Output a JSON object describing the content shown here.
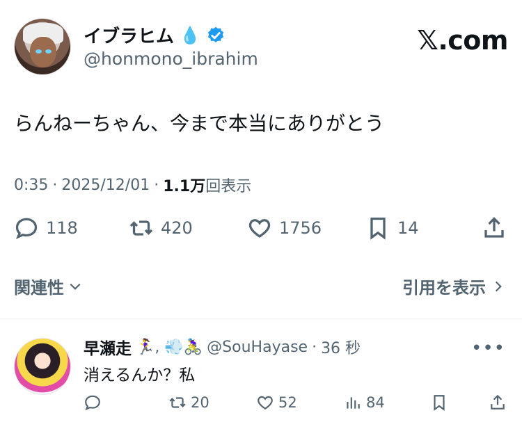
{
  "author": {
    "name": "イブラヒム",
    "name_emoji": "💧",
    "handle": "@honmono_ibrahim",
    "verified_icon": "verified-badge-icon"
  },
  "brand": "𝕏.com",
  "tweet": {
    "text": "らんねーちゃん、今まで本当にありがとう",
    "time": "0:35",
    "date": "2025/12/01",
    "views_number": "1.1万",
    "views_suffix": "回表示",
    "sep": "·"
  },
  "stats": {
    "replies": "118",
    "retweets": "420",
    "likes": "1756",
    "bookmarks": "14"
  },
  "links": {
    "related": "関連性",
    "quotes": "引用を表示"
  },
  "reply": {
    "name": "早瀬走",
    "name_emojis": "🏃‍♀️, 💨🚴‍♀️",
    "handle": "@SouHayase",
    "sep": "·",
    "time": "36 秒",
    "text": "消えるんか？私",
    "more": "•••",
    "stats": {
      "retweets": "20",
      "likes": "52",
      "views": "84"
    }
  },
  "colors": {
    "text": "#0f1419",
    "muted": "#536471",
    "verified": "#1d9bf0",
    "divider": "#eff3f4"
  }
}
